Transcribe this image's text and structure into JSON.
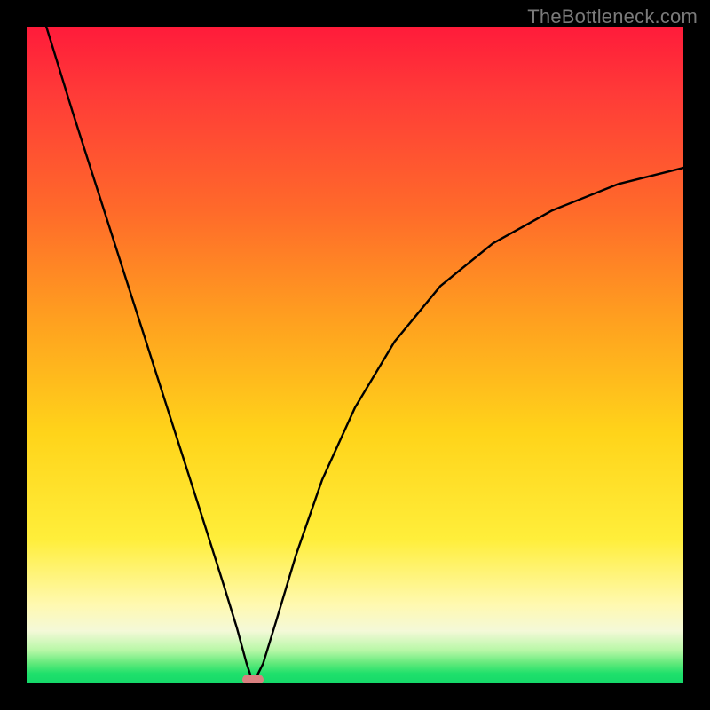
{
  "watermark": {
    "text": "TheBottleneck.com"
  },
  "colors": {
    "frame": "#000000",
    "curve": "#000000",
    "marker": "#d98080",
    "gradient_stops": [
      "#ff1b3a",
      "#ff3a38",
      "#ff6a2a",
      "#ffa11f",
      "#ffd41a",
      "#ffee3a",
      "#fff9b0",
      "#f4f9d8",
      "#b7f7a6",
      "#5fe97a",
      "#1fe06b",
      "#15d96a"
    ]
  },
  "chart_data": {
    "type": "line",
    "title": "",
    "xlabel": "",
    "ylabel": "",
    "xlim": [
      0,
      1
    ],
    "ylim": [
      0,
      1
    ],
    "note": "V-shaped bottleneck curve; y≈0 at notch, rising sharply on both sides. Values estimated from pixels (no axis ticks present).",
    "notch_x": 0.345,
    "series": [
      {
        "name": "bottleneck-curve",
        "x": [
          0.03,
          0.07,
          0.11,
          0.15,
          0.19,
          0.23,
          0.27,
          0.3,
          0.32,
          0.335,
          0.345,
          0.36,
          0.38,
          0.41,
          0.45,
          0.5,
          0.56,
          0.63,
          0.71,
          0.8,
          0.9,
          1.0
        ],
        "y": [
          1.0,
          0.87,
          0.745,
          0.62,
          0.495,
          0.37,
          0.245,
          0.15,
          0.085,
          0.03,
          0.0,
          0.03,
          0.095,
          0.195,
          0.31,
          0.42,
          0.52,
          0.605,
          0.67,
          0.72,
          0.76,
          0.785
        ]
      }
    ],
    "marker": {
      "x": 0.345,
      "y": 0.0,
      "shape": "pill"
    }
  }
}
